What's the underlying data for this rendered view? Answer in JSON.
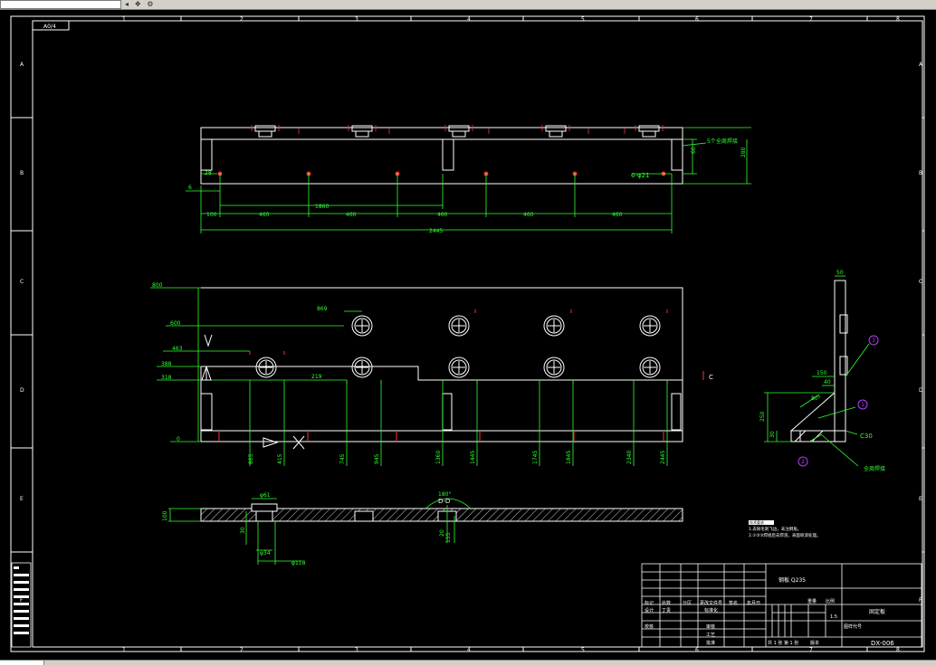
{
  "toolbar": {
    "icons": [
      "nav-left-icon",
      "layer-icon",
      "settings-icon"
    ]
  },
  "drawing": {
    "corner_label": "A0/4",
    "top_markers": [
      "1",
      "2",
      "3",
      "4",
      "5",
      "6",
      "7",
      "8"
    ],
    "bottom_markers": [
      "1",
      "2",
      "3",
      "4",
      "5",
      "6",
      "7",
      "8"
    ],
    "left_markers": [
      "A",
      "B",
      "C",
      "D",
      "E",
      "F"
    ],
    "right_markers": [
      "A",
      "B",
      "C",
      "D",
      "E",
      "F"
    ],
    "front_view": {
      "dims_bottom": [
        "100",
        "460",
        "460",
        "460",
        "460",
        "460"
      ],
      "dim_total": "2445",
      "dim_mid": "1860",
      "dim_left": "28",
      "dim_left2": "6",
      "hole_label": "6-φ21",
      "weld_label": "5个全周焊接",
      "right_dims": [
        "60",
        "280"
      ]
    },
    "plan_view": {
      "left_dims": [
        "800",
        "600",
        "463",
        "388",
        "318",
        "0"
      ],
      "top_dim": "869",
      "inner_dim": "219",
      "bottom_dims": [
        "865",
        "415",
        "745",
        "945",
        "1360",
        "1445",
        "1745",
        "1845",
        "2340",
        "2445"
      ],
      "section_letter": "C"
    },
    "side_view": {
      "dims": [
        "50",
        "100",
        "150",
        "40",
        "80°",
        "30",
        "250",
        "60"
      ],
      "chamfer": "C30",
      "weld_note": "全周焊接",
      "balloons": [
        "3",
        "1",
        "2"
      ]
    },
    "section_view": {
      "dims": [
        "φ61",
        "φ34",
        "φ118",
        "100",
        "30",
        "20",
        "155",
        "30"
      ],
      "section_label": "D-D",
      "angle": "180°"
    },
    "notes": {
      "heading": "技术要求",
      "line1": "1.去除毛刺飞边，未注倒角。",
      "line2": "2.①②③焊接后去焊渣，表面喷漆处理。"
    },
    "title_block": {
      "material": "钢板 Q235",
      "part_name": "固定板",
      "drawing_no": "DX-006",
      "scale": "1:5",
      "row_labels": [
        "标记",
        "处数",
        "分区",
        "更改文件号",
        "签名",
        "年月日"
      ],
      "roles": [
        "设计",
        "校核",
        "审核",
        "工艺",
        "标准化",
        "批准"
      ],
      "designer": "丁贵",
      "stage_labels": [
        "阶段标记",
        "重量",
        "比例"
      ],
      "sheet_text": "共 1 张 第 1 张",
      "version": "版本",
      "footer_label": "图样代号",
      "left_block_labels": [
        "借用件登记",
        "旧底图总号",
        "底图总号",
        "签字",
        "日期"
      ]
    }
  }
}
